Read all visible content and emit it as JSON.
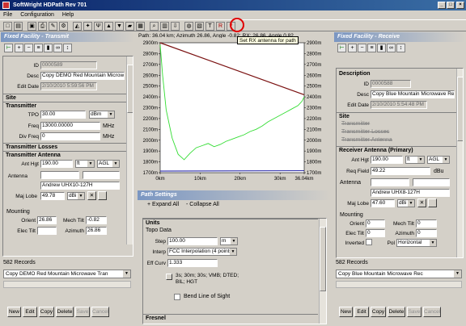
{
  "window": {
    "title": "SoftWright HDPath Rev 701"
  },
  "menu": [
    "File",
    "Configuration",
    "Help"
  ],
  "toolbar": {
    "icons": [
      "new-icon",
      "open-icon",
      "save-icon",
      "print-icon",
      "edit-icon",
      "settings-icon",
      "profile-icon",
      "compass-icon",
      "antenna-icon",
      "transmit-icon",
      "receive-icon",
      "terrain-icon",
      "clutter-icon",
      "zoom-icon",
      "report-icon",
      "export-icon",
      "globe-icon",
      "map-icon",
      "tx-antenna-icon",
      "rx-antenna-icon",
      "help-icon"
    ],
    "tooltip": "Set RX antenna for path"
  },
  "path_info": "Path: 36.04 km; Azimuth 26.86, Angle -0.82; RX: 26.86, Angle 0.82",
  "left": {
    "header": "Fixed Facility - Transmit",
    "id_label": "ID",
    "id": "0000589",
    "desc_label": "Desc",
    "desc": "Copy DEMO Red Mountain Microwave",
    "editdate_label": "Edit Date",
    "editdate": "2/10/2010 5:59:56 PM",
    "site": "Site",
    "transmitter": "Transmitter",
    "tpo_label": "TPO",
    "tpo": "30.00",
    "tpo_unit": "dBm",
    "freq_label": "Freq",
    "freq": "13000.00000",
    "freq_unit": "MHz",
    "div_label": "Div Freq",
    "div": "0",
    "div_unit": "MHz",
    "losses": "Transmitter Losses",
    "antenna_sec": "Transmitter Antenna",
    "anthgt_label": "Ant Hgt",
    "anthgt": "190.00",
    "anthgt_unit": "ft",
    "anthgt_ref": "AGL",
    "antenna_label": "Antenna",
    "antenna": "Andrew UHX10-127H",
    "majlobe_label": "Maj Lobe",
    "majlobe": "49.78",
    "majlobe_unit": "dBi",
    "mounting": "Mounting",
    "orient_label": "Orient",
    "orient": "26.86",
    "mtilt_label": "Mech Tilt",
    "mtilt": "-0.82",
    "eltilt_label": "Elec Tilt",
    "azimuth_label": "Azimuth",
    "azimuth": "26.86",
    "records": "582 Records",
    "record_sel": "Copy DEMO Red Mountain Microwave Tran",
    "buttons": [
      "New",
      "Edit",
      "Copy",
      "Delete",
      "Save",
      "Cancel"
    ]
  },
  "right": {
    "header": "Fixed Facility - Receive",
    "description": "Description",
    "id_label": "ID",
    "id": "0000588",
    "desc_label": "Desc",
    "desc": "Copy Blue Mountain Microwave Re",
    "editdate_label": "Edit Date",
    "editdate": "2/10/2010 5:54:48 PM",
    "site": "Site",
    "sub1": "Transmitter",
    "sub2": "Transmitter Losses",
    "sub3": "Transmitter Antenna",
    "rx_antenna": "Receiver Antenna (Primary)",
    "anthgt_label": "Ant Hgt",
    "anthgt": "190.00",
    "anthgt_unit": "ft",
    "anthgt_ref": "AGL",
    "reqfield_label": "Req Field",
    "reqfield": "49.22",
    "reqfield_unit": "dBu",
    "antenna_label": "Antenna",
    "antenna": "Andrew UHX8-127H",
    "majlobe_label": "Maj Lobe",
    "majlobe": "47.60",
    "majlobe_unit": "dBi",
    "mounting": "Mounting",
    "orient_label": "Orient",
    "orient": "0",
    "mtilt_label": "Mech Tilt",
    "mtilt": "0",
    "eltilt_label": "Elec Tilt",
    "eltilt": "0",
    "azimuth_label": "Azimuth",
    "azimuth": "0",
    "inverted_label": "Inverted",
    "pol_label": "Pol",
    "pol": "Horizontal",
    "records": "582 Records",
    "record_sel": "Copy Blue Mountain Microwave Rec",
    "buttons": [
      "New",
      "Edit",
      "Copy",
      "Delete",
      "Save",
      "Cancel"
    ]
  },
  "path_settings": {
    "header": "Path Settings",
    "expand": "+ Expand All",
    "collapse": "- Collapse All",
    "units": "Units",
    "topo": "Topo Data",
    "step_label": "Step",
    "step": "100.00",
    "step_unit": "m",
    "interp_label": "Interp",
    "interp": "FCC Interpolation (4 points)",
    "effcurv_label": "Eff Curv",
    "effcurv": "1.333",
    "topo_note": "3s; 30m; 30s; VMB; DTED; BIL; HGT",
    "bend": "Bend Line of Sight",
    "fresnel": "Fresnel"
  },
  "chart_data": {
    "type": "line",
    "y_left_ticks": [
      "2900m",
      "2800m",
      "2700m",
      "2600m",
      "2500m",
      "2400m",
      "2300m",
      "2200m",
      "2100m",
      "2000m",
      "1900m",
      "1800m",
      "1700m"
    ],
    "y_right_ticks": [
      "2900m",
      "2800m",
      "2700m",
      "2600m",
      "2500m",
      "2400m",
      "2300m",
      "2200m",
      "2100m",
      "2000m",
      "1900m",
      "1800m",
      "1700m"
    ],
    "x_ticks": [
      "0km",
      "10km",
      "20km",
      "30km",
      "36.04km"
    ],
    "ylim": [
      1700,
      2900
    ],
    "xlim": [
      0,
      36.04
    ],
    "colors": {
      "los": "#7a1010",
      "terrain": "#33dd33",
      "base": "#1010a0"
    },
    "series": [
      {
        "role": "line of sight",
        "points": [
          [
            0,
            2900
          ],
          [
            36.04,
            2420
          ]
        ]
      },
      {
        "role": "terrain",
        "points": [
          [
            0,
            2880
          ],
          [
            0.6,
            2600
          ],
          [
            1.5,
            2280
          ],
          [
            3,
            2020
          ],
          [
            4.5,
            1870
          ],
          [
            6,
            1820
          ],
          [
            7.5,
            1880
          ],
          [
            9,
            1930
          ],
          [
            10.5,
            1950
          ],
          [
            12,
            1970
          ],
          [
            13.5,
            1940
          ],
          [
            15,
            1960
          ],
          [
            16.5,
            1990
          ],
          [
            18,
            2010
          ],
          [
            19.5,
            2030
          ],
          [
            21,
            2050
          ],
          [
            22.5,
            2080
          ],
          [
            24,
            2100
          ],
          [
            25.5,
            2130
          ],
          [
            27,
            2170
          ],
          [
            28.5,
            2200
          ],
          [
            30,
            2230
          ],
          [
            31.5,
            2260
          ],
          [
            33,
            2290
          ],
          [
            34.5,
            2320
          ],
          [
            35.5,
            2360
          ],
          [
            36.04,
            2400
          ]
        ]
      },
      {
        "role": "baseline",
        "points": [
          [
            0,
            1715
          ],
          [
            36.04,
            1718
          ]
        ]
      }
    ]
  }
}
